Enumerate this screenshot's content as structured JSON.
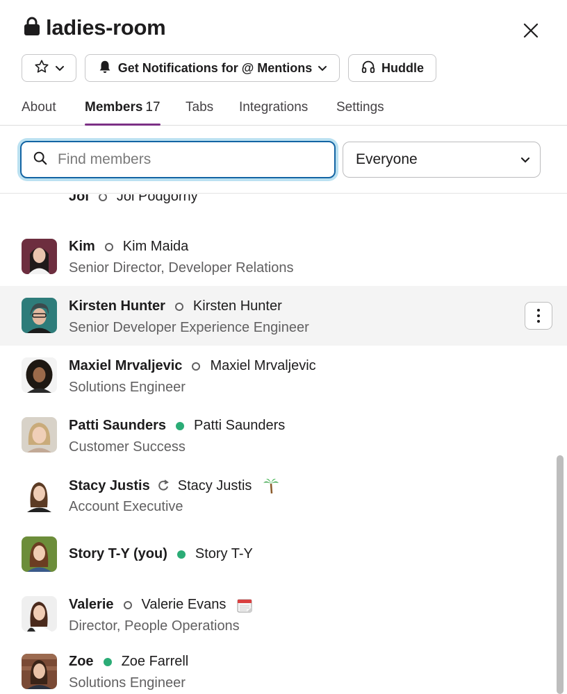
{
  "channel": {
    "name": "ladies-room",
    "lock_icon": "lock-icon",
    "close_icon": "close-icon"
  },
  "actions": {
    "star_icon": "star-icon",
    "notifications_label": "Get Notifications for @ Mentions",
    "huddle_label": "Huddle"
  },
  "tabs": [
    {
      "label": "About"
    },
    {
      "label": "Members",
      "count": "17",
      "active": true
    },
    {
      "label": "Tabs"
    },
    {
      "label": "Integrations"
    },
    {
      "label": "Settings"
    }
  ],
  "search": {
    "placeholder": "Find members",
    "value": ""
  },
  "filter": {
    "selected": "Everyone"
  },
  "members": [
    {
      "display": "Joi",
      "full": "Joi Podgorny",
      "title": "",
      "status": "away"
    },
    {
      "display": "Kim",
      "full": "Kim Maida",
      "title": "Senior Director, Developer Relations",
      "status": "away"
    },
    {
      "display": "Kirsten Hunter",
      "full": "Kirsten Hunter",
      "title": "Senior Developer Experience Engineer",
      "status": "away",
      "hover": true
    },
    {
      "display": "Maxiel Mrvaljevic",
      "full": "Maxiel Mrvaljevic",
      "title": "Solutions Engineer",
      "status": "away"
    },
    {
      "display": "Patti Saunders",
      "full": "Patti Saunders",
      "title": "Customer Success",
      "status": "active"
    },
    {
      "display": "Stacy Justis",
      "full": "Stacy Justis",
      "title": "Account Executive",
      "status": "external",
      "emoji": "palm-tree-icon"
    },
    {
      "display": "Story T-Y (you)",
      "full": "Story T-Y",
      "title": "",
      "status": "active"
    },
    {
      "display": "Valerie",
      "full": "Valerie Evans",
      "title": "Director, People Operations",
      "status": "away",
      "emoji": "calendar-icon"
    },
    {
      "display": "Zoe",
      "full": "Zoe Farrell",
      "title": "Solutions Engineer",
      "status": "active"
    }
  ],
  "colors": {
    "accent": "#7c3085",
    "focus": "#1264a3",
    "active_presence": "#2bac76",
    "hover_row": "#f4f4f4"
  }
}
